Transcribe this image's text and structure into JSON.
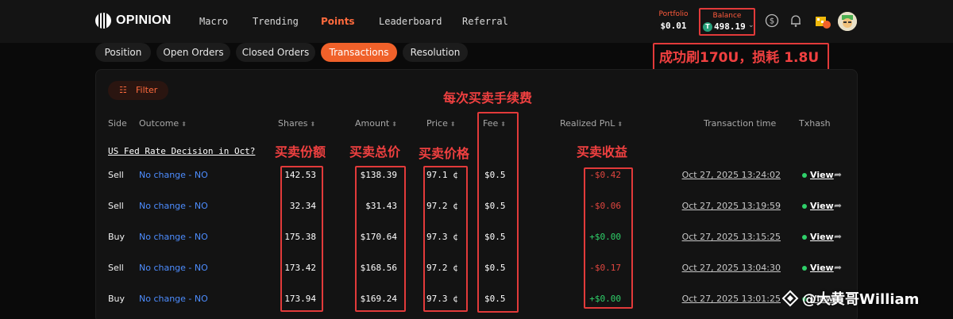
{
  "header": {
    "logo_text": "OPINION",
    "nav": [
      "Macro",
      "Trending",
      "Points",
      "Leaderboard",
      "Referral"
    ],
    "active_nav": "Points",
    "portfolio_label": "Portfolio",
    "portfolio_value": "$0.01",
    "balance_label": "Balance",
    "balance_value": "498.19",
    "coin_symbol": "T",
    "accent": "#f0612a"
  },
  "tabs": [
    "Position",
    "Open Orders",
    "Closed Orders",
    "Transactions",
    "Resolution"
  ],
  "active_tab": "Transactions",
  "filter_label": "Filter",
  "columns": [
    "Side",
    "Outcome",
    "Shares",
    "Amount",
    "Price",
    "Fee",
    "Realized PnL",
    "Transaction time",
    "Txhash"
  ],
  "market_title": "US Fed Rate Decision in Oct?",
  "rows": [
    {
      "side": "Sell",
      "outcome": "No change - NO",
      "shares": "142.53",
      "amount": "$138.39",
      "price": "97.1 ¢",
      "fee": "$0.5",
      "pnl": "-$0.42",
      "time": "Oct 27, 2025 13:24:02",
      "tx": "View"
    },
    {
      "side": "Sell",
      "outcome": "No change - NO",
      "shares": "32.34",
      "amount": "$31.43",
      "price": "97.2 ¢",
      "fee": "$0.5",
      "pnl": "-$0.06",
      "time": "Oct 27, 2025 13:19:59",
      "tx": "View"
    },
    {
      "side": "Buy",
      "outcome": "No change - NO",
      "shares": "175.38",
      "amount": "$170.64",
      "price": "97.3 ¢",
      "fee": "$0.5",
      "pnl": "+$0.00",
      "time": "Oct 27, 2025 13:15:25",
      "tx": "View"
    },
    {
      "side": "Sell",
      "outcome": "No change - NO",
      "shares": "173.42",
      "amount": "$168.56",
      "price": "97.2 ¢",
      "fee": "$0.5",
      "pnl": "-$0.17",
      "time": "Oct 27, 2025 13:04:30",
      "tx": "View"
    },
    {
      "side": "Buy",
      "outcome": "No change - NO",
      "shares": "173.94",
      "amount": "$169.24",
      "price": "97.3 ¢",
      "fee": "$0.5",
      "pnl": "+$0.00",
      "time": "Oct 27, 2025 13:01:25",
      "tx": "View"
    }
  ],
  "annotations": {
    "top": "成功刷170U，损耗 1.8U",
    "fee": "每次买卖手续费",
    "shares": "买卖份额",
    "amount": "买卖总价",
    "price": "买卖价格",
    "pnl": "买卖收益",
    "color": "#e23a3a"
  },
  "watermark": "@大黄哥William"
}
